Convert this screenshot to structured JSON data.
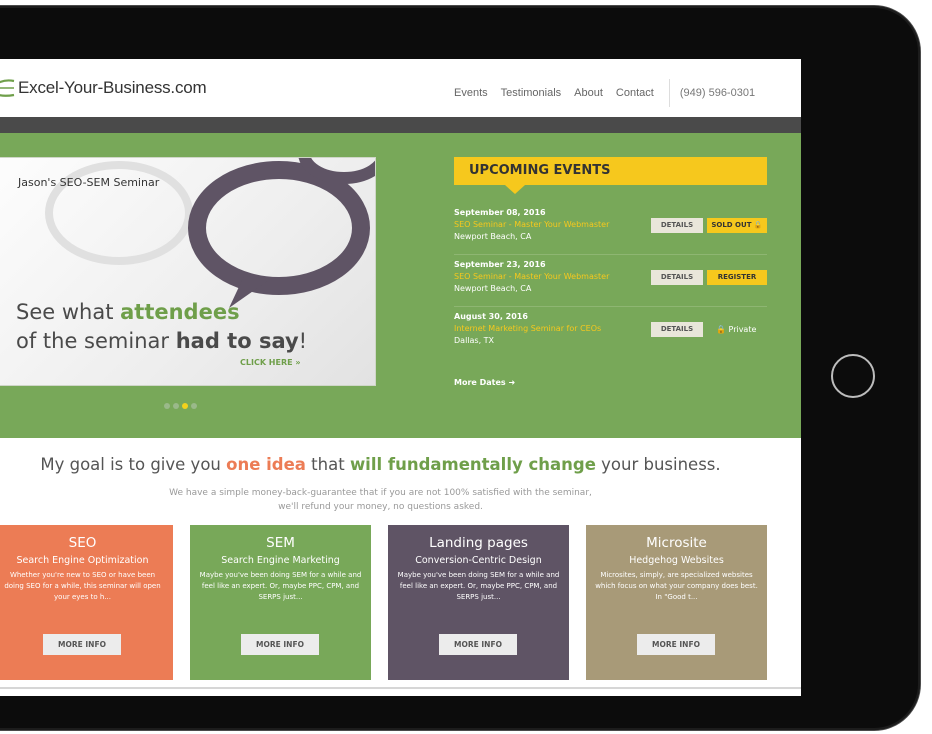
{
  "colors": {
    "hero_green": "#78a859",
    "accent_yellow": "#f6c81d",
    "accent_orange": "#ec7c55",
    "accent_green": "#6f9f4a",
    "seo_card": "#ec7c55",
    "sem_card": "#78a859",
    "landing_card": "#5f5465",
    "microsite_card": "#a89a78"
  },
  "header": {
    "logo": "Excel-Your-Business.com",
    "nav": [
      "Events",
      "Testimonials",
      "About",
      "Contact"
    ],
    "phone": "(949) 596-0301"
  },
  "slider": {
    "title": "Jason's SEO-SEM Seminar",
    "line1_a": "See what ",
    "line1_b": "attendees",
    "line2_a": "of the seminar ",
    "line2_b": "had to say",
    "line2_c": "!",
    "cta": "CLICK HERE »",
    "dots": 4,
    "active_dot": 3
  },
  "events": {
    "heading": "UPCOMING EVENTS",
    "items": [
      {
        "date": "September 08, 2016",
        "title": "SEO Seminar - Master Your Webmaster",
        "location": "Newport Beach, CA",
        "details": "DETAILS",
        "status": "SOLD OUT 🔒"
      },
      {
        "date": "September 23, 2016",
        "title": "SEO Seminar - Master Your Webmaster",
        "location": "Newport Beach, CA",
        "details": "DETAILS",
        "status": "REGISTER"
      },
      {
        "date": "August 30, 2016",
        "title": "Internet Marketing Seminar for CEOs",
        "location": "Dallas, TX",
        "details": "DETAILS",
        "status": "🔒 Private"
      }
    ],
    "more": "More Dates ➜"
  },
  "goal": {
    "a": "My goal is to give you ",
    "b": "one idea",
    "c": " that ",
    "d": "will fundamentally change",
    "e": " your business."
  },
  "guarantee": {
    "line1": "We have a simple money-back-guarantee that if you are not 100% satisfied with the seminar,",
    "line2": "we'll refund your money, no questions asked."
  },
  "cards": [
    {
      "title": "SEO",
      "subtitle": "Search Engine Optimization",
      "desc": "Whether you're new to SEO or have been doing SEO for a while, this seminar will open your eyes to h...",
      "button": "MORE INFO"
    },
    {
      "title": "SEM",
      "subtitle": "Search Engine Marketing",
      "desc": "Maybe you've been doing SEM for a while and feel like an expert. Or, maybe PPC, CPM, and SERPS just...",
      "button": "MORE INFO"
    },
    {
      "title": "Landing pages",
      "subtitle": "Conversion-Centric Design",
      "desc": "Maybe you've been doing SEM for a while and feel like an expert. Or, maybe PPC, CPM, and SERPS just...",
      "button": "MORE INFO"
    },
    {
      "title": "Microsite",
      "subtitle": "Hedgehog Websites",
      "desc": "Microsites, simply, are specialized websites which focus on what your company does best. In \"Good t...",
      "button": "MORE INFO"
    }
  ]
}
